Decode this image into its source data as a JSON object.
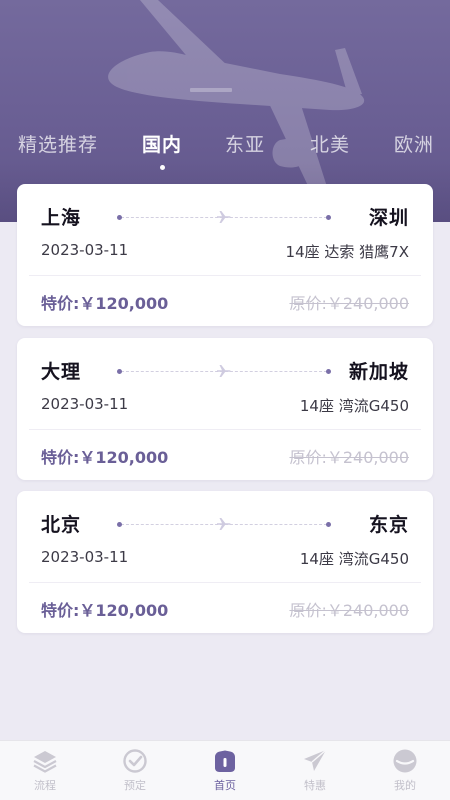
{
  "tabs": [
    {
      "label": "精选推荐"
    },
    {
      "label": "国内"
    },
    {
      "label": "东亚"
    },
    {
      "label": "北美"
    },
    {
      "label": "欧洲"
    }
  ],
  "active_tab": "国内",
  "flights": [
    {
      "from": "上海",
      "to": "深圳",
      "date": "2023-03-11",
      "seats": "14座  达索 猎鹰7X",
      "special_price": "特价:￥120,000",
      "original_price": "原价:￥240,000"
    },
    {
      "from": "大理",
      "to": "新加坡",
      "date": "2023-03-11",
      "seats": "14座  湾流G450",
      "special_price": "特价:￥120,000",
      "original_price": "原价:￥240,000"
    },
    {
      "from": "北京",
      "to": "东京",
      "date": "2023-03-11",
      "seats": "14座  湾流G450",
      "special_price": "特价:￥120,000",
      "original_price": "原价:￥240,000"
    }
  ],
  "tabbar": [
    {
      "label": "流程",
      "icon": "layers-icon"
    },
    {
      "label": "预定",
      "icon": "check-circle-icon"
    },
    {
      "label": "首页",
      "icon": "home-icon"
    },
    {
      "label": "特惠",
      "icon": "paper-plane-icon"
    },
    {
      "label": "我的",
      "icon": "smile-face-icon"
    }
  ],
  "active_tabbar": "首页",
  "colors": {
    "header": "#6a5f94",
    "accent": "#6a5f97",
    "background": "#eceaf3",
    "card": "#ffffff",
    "strike_price": "#c5c2cf"
  }
}
